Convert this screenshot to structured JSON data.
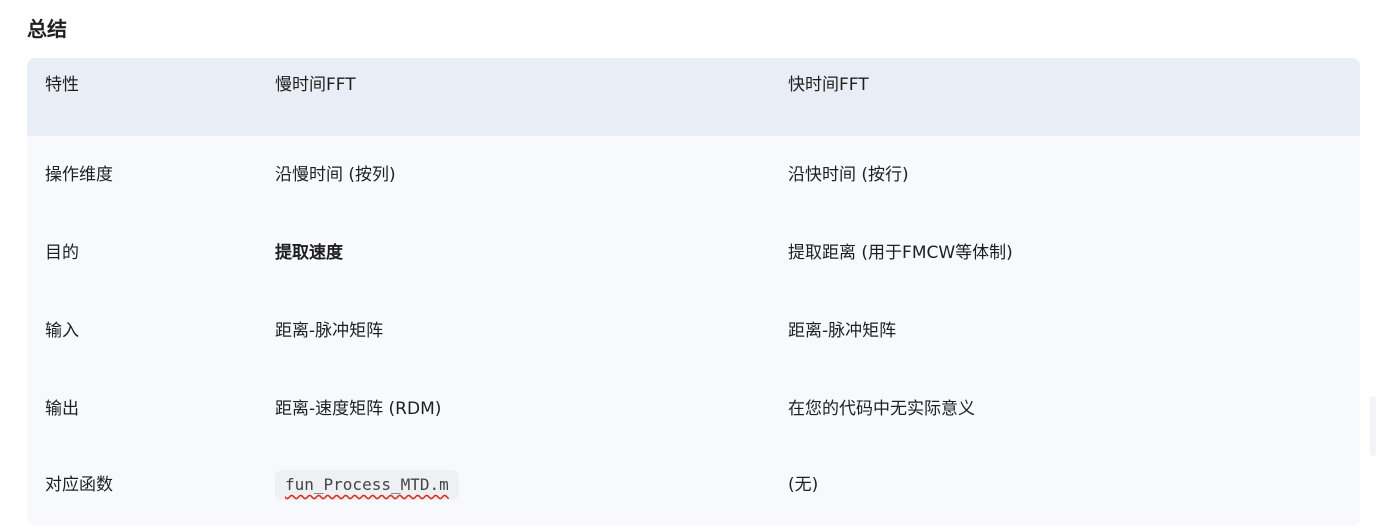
{
  "heading": "总结",
  "table": {
    "headers": [
      "特性",
      "慢时间FFT",
      "快时间FFT"
    ],
    "rows": [
      {
        "feature": "操作维度",
        "slow": "沿慢时间 (按列)",
        "fast": "沿快时间 (按行)"
      },
      {
        "feature": "目的",
        "slow": "提取速度",
        "fast": "提取距离 (用于FMCW等体制)"
      },
      {
        "feature": "输入",
        "slow": "距离-脉冲矩阵",
        "fast": "距离-脉冲矩阵"
      },
      {
        "feature": "输出",
        "slow": "距离-速度矩阵 (RDM)",
        "fast": "在您的代码中无实际意义"
      },
      {
        "feature": "对应函数",
        "slow": "fun_Process_MTD.m",
        "fast": "(无)"
      }
    ]
  }
}
